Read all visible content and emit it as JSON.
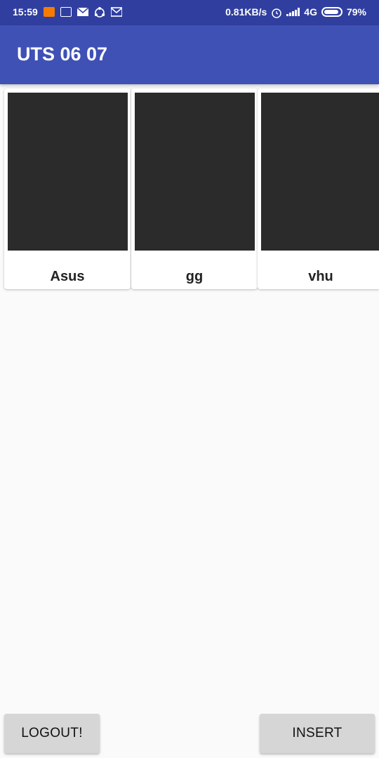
{
  "status_bar": {
    "time": "15:59",
    "net_speed": "0.81KB/s",
    "network": "4G",
    "battery": "79%",
    "icons": [
      "mi-icon",
      "app-icon",
      "mail-icon",
      "share-icon",
      "gmail-icon",
      "alarm-icon",
      "signal-icon",
      "battery-icon"
    ]
  },
  "app_bar": {
    "title": "UTS 06 07"
  },
  "items": [
    {
      "label": "Asus"
    },
    {
      "label": "gg"
    },
    {
      "label": "vhu"
    }
  ],
  "buttons": {
    "logout": "LOGOUT!",
    "insert": "INSERT"
  },
  "colors": {
    "primary": "#3F51B5",
    "primary_dark": "#303F9F",
    "image_placeholder": "#2B2B2B",
    "button": "#D6D6D6"
  }
}
